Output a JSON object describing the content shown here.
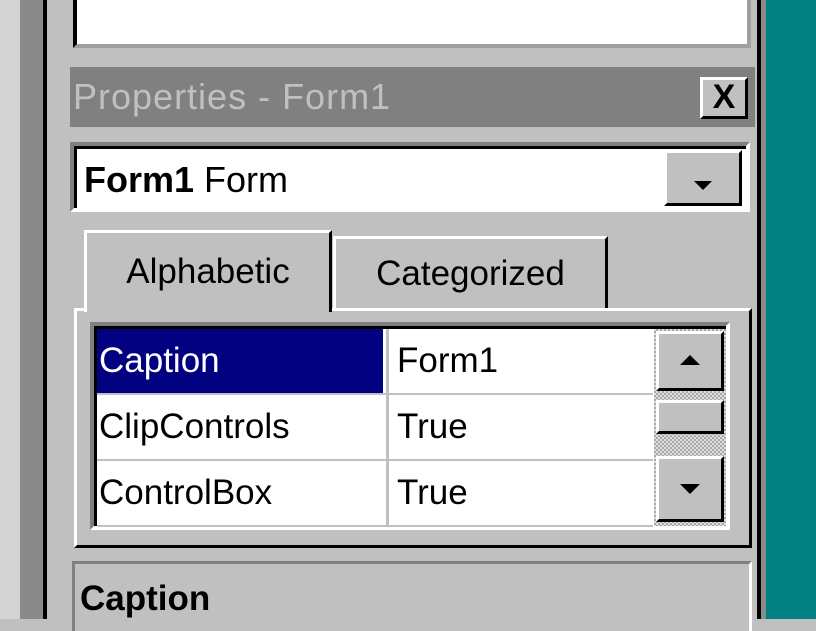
{
  "window": {
    "title": "Properties - Form1",
    "close_label": "X"
  },
  "object_selector": {
    "object_name": "Form1",
    "object_type": "Form"
  },
  "tabs": [
    {
      "label": "Alphabetic",
      "selected": true
    },
    {
      "label": "Categorized",
      "selected": false
    }
  ],
  "properties": [
    {
      "name": "Caption",
      "value": "Form1",
      "selected": true
    },
    {
      "name": "ClipControls",
      "value": "True",
      "selected": false
    },
    {
      "name": "ControlBox",
      "value": "True",
      "selected": false
    }
  ],
  "description": {
    "title": "Caption"
  },
  "colors": {
    "selection": "#000080",
    "desktop": "#008080",
    "face": "#c0c0c0",
    "title_inactive": "#808080"
  }
}
